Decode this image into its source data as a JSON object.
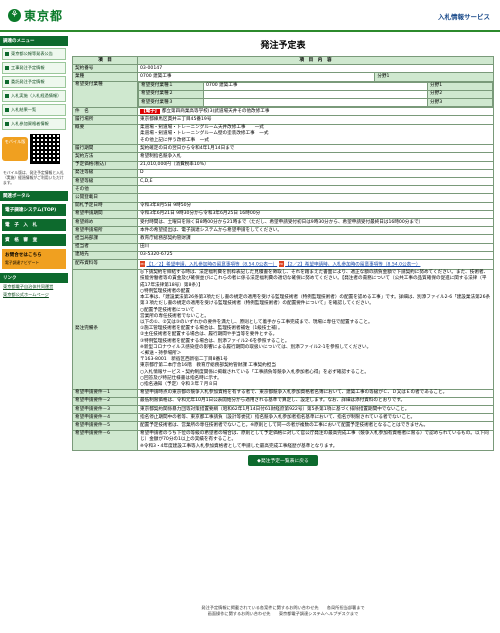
{
  "header": {
    "logo_mark": "⚘",
    "logo_text": "東京都",
    "system_title": "入札情報サービス"
  },
  "sidebar": {
    "menu_heading": "調達のメニュー",
    "items": [
      {
        "label": "東京都公報等発表公告"
      },
      {
        "label": "工事発注予定情報"
      },
      {
        "label": "委託発注予定情報"
      },
      {
        "label": "入札実施（入札経過情報）"
      },
      {
        "label": "入札結果一覧"
      },
      {
        "label": "入札参加資格者情報"
      }
    ],
    "mobile_label": "モバイル版",
    "mobile_note": "モバイル版は、発注予定情報と入札（実施）経過情報がご利用いただけます。",
    "portal_heading": "関連ポータル",
    "portal_items": [
      {
        "label": "電子調達システム(TOP)"
      },
      {
        "label": "電　子　入　札"
      },
      {
        "label": "資　格　審　査"
      }
    ],
    "orange_label": "お問合せはこちら",
    "orange_sub": "電子調達ナビゲート",
    "link_heading": "リンク",
    "links": [
      {
        "label": "東京都電子自治体共同運営"
      },
      {
        "label": "東京都公式ホームページ"
      }
    ]
  },
  "page": {
    "title": "発注予定表"
  },
  "table": {
    "header_item": "項　目",
    "header_content": "項　目　内　容",
    "rows": [
      {
        "label": "契約番号",
        "value": "03-00147"
      },
      {
        "label": "業種",
        "value": "0700 建築工事",
        "extra_label": "分野1",
        "extra_value": ""
      }
    ],
    "desired": {
      "label": "希望受付業種",
      "rows": [
        {
          "k": "希望受付業種１",
          "v": "0700 建築工事",
          "f": "分野1"
        },
        {
          "k": "希望受付業種２",
          "v": "",
          "f": "分野2"
        },
        {
          "k": "希望受付業種３",
          "v": "",
          "f": "分野3"
        }
      ]
    },
    "name_label": "件　名",
    "name_badge": "【電子】",
    "name_value": "都立第四商業高等学校(3)武道場天井その他改修工事",
    "place_label": "履行場所",
    "place_value": "東京都練馬区貫井三丁目45番19号",
    "summary_label": "概要",
    "summary_lines": [
      "柔道場・剣道場・トレーニングルーム天井改修工事　　一式",
      "柔道場・剣道場・トレーニングルーム壁の塗装改修工事　一式",
      "その他上記に伴う改修工事　一式"
    ],
    "rows2": [
      {
        "label": "履行期間",
        "value": "契約確定の日の翌日から令和4年1月14日まで"
      },
      {
        "label": "契約方法",
        "value": "希望制指名競争入札"
      },
      {
        "label": "予定価格(税込)",
        "value": "21,010,000円（消費税率10%）"
      },
      {
        "label": "発注等級",
        "value": "D"
      },
      {
        "label": "希望等級",
        "value": "C,D,E"
      },
      {
        "label": "その他",
        "value": ""
      },
      {
        "label": "公開登載日",
        "value": ""
      },
      {
        "label": "開札予定日時",
        "value": "令和3年8月5日 9時50分"
      },
      {
        "label": "希望申請期間",
        "value": "令和3年6月21日 9時30分から令和3年6月25日 16時00分"
      },
      {
        "label": "希望締め",
        "value": "受付時間は、土曜日を除く日8時00分から21時まで（ただし、希望申請受付初日は9時30分から、希望申請受付最終日は16時00分まで）"
      },
      {
        "label": "希望申請場所",
        "value": "本件の希望提出は、電子調達システムから希望申請をしてください。"
      },
      {
        "label": "担当局部課",
        "value": "教育庁総務部契約管財課"
      },
      {
        "label": "担当者",
        "value": "田川"
      },
      {
        "label": "連絡先",
        "value": "03-5320-6725"
      }
    ],
    "attach_label": "配布資料等",
    "attachments": [
      {
        "text": "【1／2】希望申請、入札参加時の留意事項等（8.54.0公表一）"
      },
      {
        "text": "【2／2】希望申請時、入札参加時の留意事項等（8.54.0公表一）"
      }
    ],
    "conditions_label": "発注完備条",
    "conditions_text": "◎下請契約を締結する時は、法定福利費を別枠表記した見積書を徴取し、それを踏まえた書面により、適正な額の請負金額で下請契約に努めてください。また、技術者、技能労働者等の賃金及び確保並びにこれらの者に係る法定福利費の適切な確保に努めてください。【発注者の責務について（公共工事の品質確保の促進に関する法律（平成17年法律第18号）第8条）】\n○特例監理技術者の配置\n本工事は、「建設業法第26条第3項ただし書の規定の適用を受ける監理技術者（特例監理技術者）の配置を認める工事」です。詳細は、別添ファイル2-6「建設業法第26条第３項ただし書の規定の適用を受ける監理技術者（特例監理技術者）の配置要件について」を確認してください。\n○配置予定技術者について\n営業所の専任技術者でないこと。\n以下の①、②又は③のいずれかの要件を満たし、原則として着手から工事完成まで、現場に専任で配置すること。\n①施工管理技術者を配置する場合は、監理技術者補佐（1級技士補）。\n②主任技術者を配置する場合は、履行期間や手当等を要件とする。\n③特例監理技術者を配置する場合は、別添ファイル2-6を参照すること。\n※新型コロナウイルス感染症の影響による履行期間の取扱いについては、別添ファイル2-1を参照してください。\n＜郵送・持参場所＞\n〒163-8001　新宿区西新宿二丁目8番1号\n東京都庁第二本庁舎16階　教育庁総務部契約管財課 工事契約担当\n○入札情報サービス・契約制度関係に掲載されている「工事請負等競争入札参加者心得」を必ず確認すること。\n○回答及び特記仕様書は指名時に示す。\n○指名通知（予定）令和３年７月８日",
    "reqs": [
      {
        "label": "希望申請要件－1",
        "value": "希望申請時点の東京都の競争入札参加資格を有する者で、東京都競争入札参加資格者名簿において、建築工事の等級がＣ、Ｄ又はＥの者であること。"
      },
      {
        "label": "希望申請要件－2",
        "value": "最低制限価格は、令和元年10月1日公表開始分から適用される基準で算定し、設定します。なお、詳細は添付資料のとおりです。"
      },
      {
        "label": "希望申請要件－3",
        "value": "東京都契約関係暴力団等対策措置要綱（昭和62年1月14日付61財経庶第922号）第5条第1項に基づく排除措置期間中でないこと。"
      },
      {
        "label": "希望申請要件－4",
        "value": "指名停止期間中の者等、東京都工事請負（設計等委託）指名競争入札参加者指名基準において、指名が制限されている者でないこと。"
      },
      {
        "label": "希望申請要件－5",
        "value": "配置予定技術者は、営業所の専任技術者でないこと。※原則として同一の者が複数の工事において配置予定技術者となることはできません。"
      },
      {
        "label": "希望申請要件－6",
        "value": "希望申請者のうち下位の等級の希望者の場合は、原則として予定価格に対して官公庁発注の最高完成工事（競争入札参加有資格者に限る）で認められているもの。以下同じ）金額が70分の1以上の実績を有すること。\n※令和3・4年度建設工事等入札参加資格者として申請した最高完成工事経歴が基準となります。"
      }
    ]
  },
  "back_button": "◆発注予定一覧表に戻る",
  "footer": {
    "line1": "発注予定情報に掲載されている各案件に関するお問い合わせ先　　各局所担当部署まで",
    "line2": "画面操作に関するお問い合わせ先　　東京都電子調達システムヘルプデスクまで"
  }
}
